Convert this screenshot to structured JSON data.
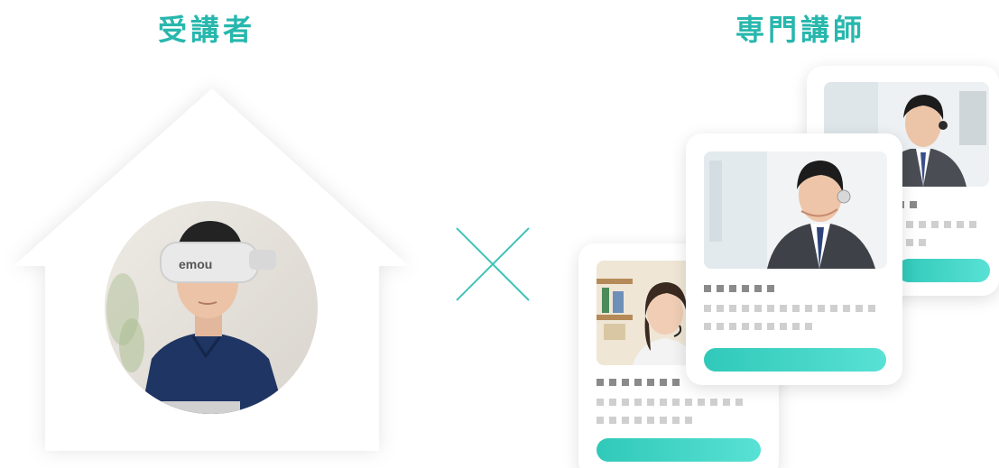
{
  "headings": {
    "learner": "受講者",
    "instructor": "専門講師"
  },
  "learner_photo": {
    "headset_brand": "emou"
  },
  "colors": {
    "accent": "#27b7ad",
    "button_gradient_start": "#30c9b9",
    "button_gradient_end": "#58e1d5",
    "placeholder_dark": "#8a8a8a",
    "placeholder_light": "#cfcfcf"
  },
  "icons": {
    "multiply": "multiplication-cross-icon",
    "house": "house-icon"
  }
}
